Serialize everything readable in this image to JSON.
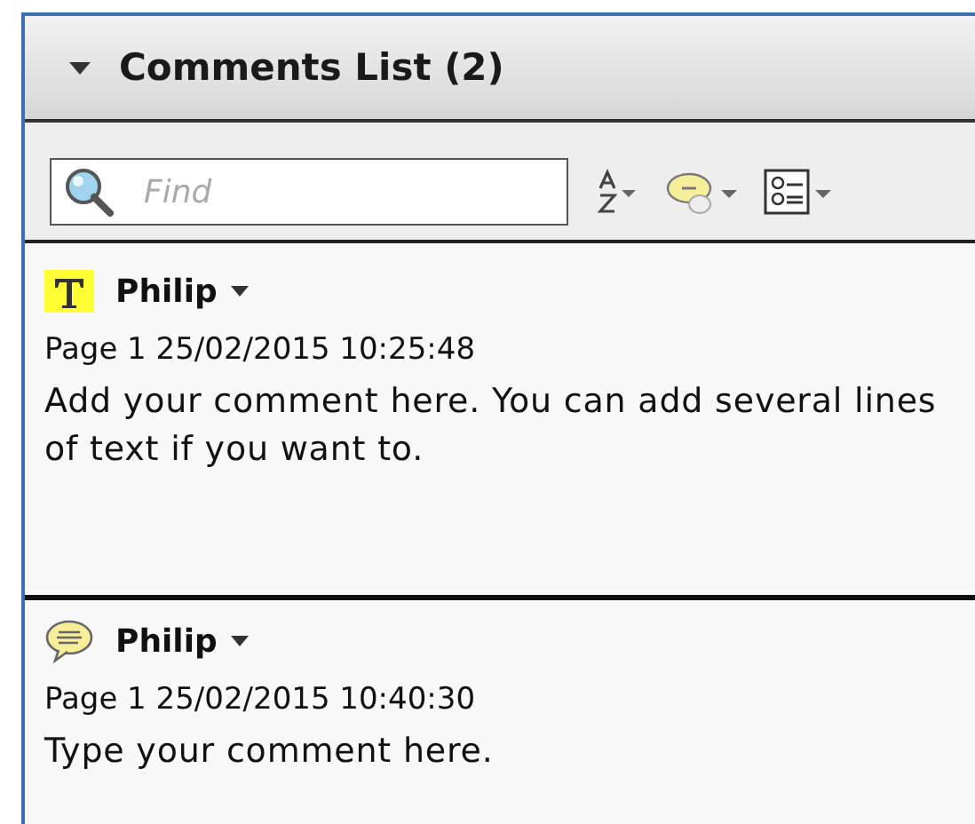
{
  "panel": {
    "title": "Comments List (2)",
    "expanded": true
  },
  "toolbar": {
    "search": {
      "placeholder": "Find"
    }
  },
  "comments": [
    {
      "kind": "text",
      "author": "Philip",
      "meta": "Page 1  25/02/2015 10:25:48",
      "body": "Add your comment here. You can add several lines of text if you want to."
    },
    {
      "kind": "note",
      "author": "Philip",
      "meta": "Page 1  25/02/2015 10:40:30",
      "body": "Type your comment here."
    }
  ]
}
